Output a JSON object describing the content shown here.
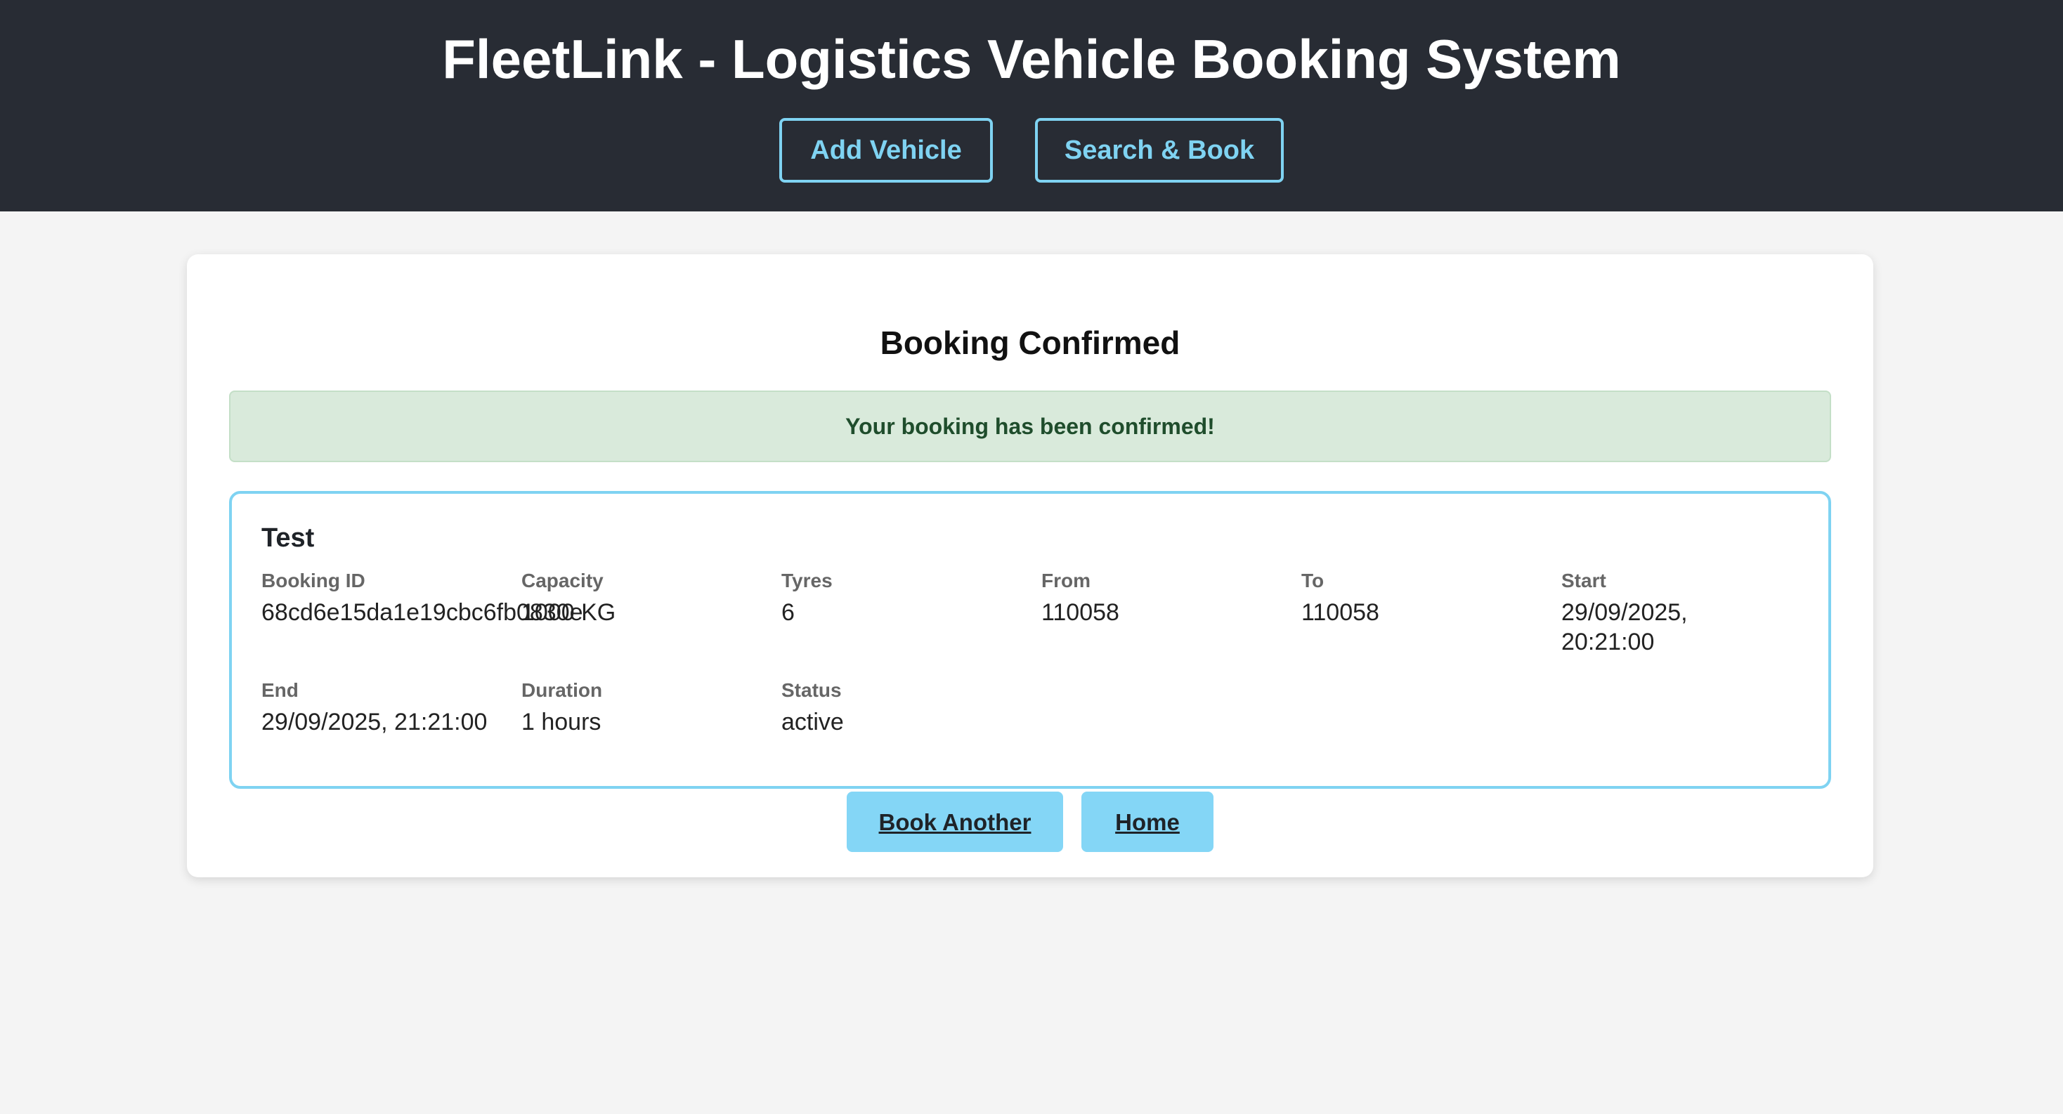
{
  "header": {
    "title": "FleetLink - Logistics Vehicle Booking System",
    "nav": {
      "add_vehicle": "Add Vehicle",
      "search_book": "Search & Book"
    }
  },
  "main": {
    "title": "Booking Confirmed",
    "alert": "Your booking has been confirmed!",
    "booking": {
      "vehicle_name": "Test",
      "fields": [
        {
          "label": "Booking ID",
          "value": "68cd6e15da1e19cbc6fb0830e"
        },
        {
          "label": "Capacity",
          "value": "1000 KG"
        },
        {
          "label": "Tyres",
          "value": "6"
        },
        {
          "label": "From",
          "value": "110058"
        },
        {
          "label": "To",
          "value": "110058"
        },
        {
          "label": "Start",
          "value": "29/09/2025, 20:21:00"
        },
        {
          "label": "End",
          "value": "29/09/2025, 21:21:00"
        },
        {
          "label": "Duration",
          "value": "1 hours"
        },
        {
          "label": "Status",
          "value": "active"
        }
      ]
    },
    "actions": {
      "book_another": "Book Another",
      "home": "Home"
    }
  },
  "colors": {
    "header_bg": "#282c34",
    "accent": "#7fd3f2",
    "button_bg": "#84d6f6",
    "alert_bg": "#d9eadb",
    "alert_text": "#1f4d2c",
    "page_bg": "#f4f4f4"
  }
}
